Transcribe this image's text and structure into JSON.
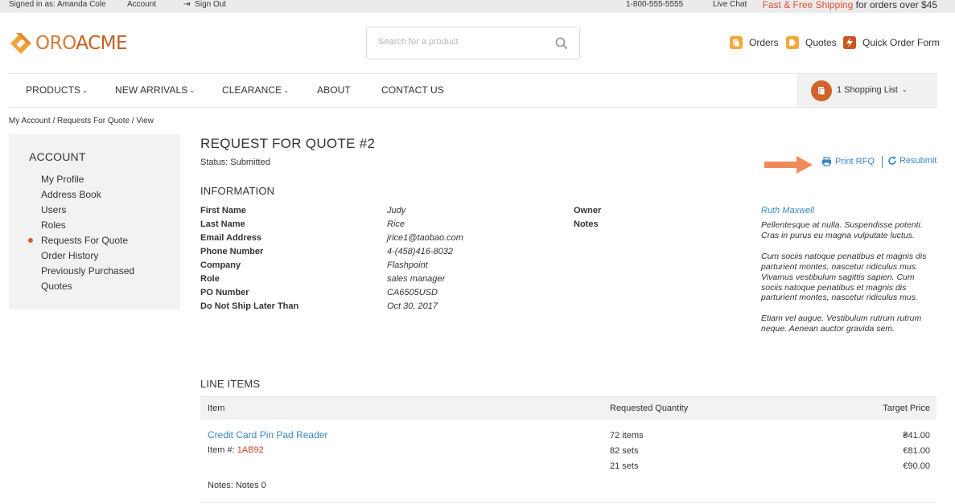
{
  "topbar": {
    "signed_in": "Signed in as: Amanda Cole",
    "account": "Account",
    "sign_out": "Sign Out",
    "phone": "1-800-555-5555",
    "live_chat": "Live Chat",
    "promo_accent": "Fast & Free Shipping",
    "promo_rest": " for orders over $45"
  },
  "header": {
    "logo_part1": "ORO",
    "logo_part2": "ACME",
    "search_placeholder": "Search for a product",
    "orders": "Orders",
    "quotes": "Quotes",
    "quick_order": "Quick Order Form"
  },
  "nav": {
    "items": [
      "PRODUCTS",
      "NEW ARRIVALS",
      "CLEARANCE",
      "ABOUT",
      "CONTACT US"
    ],
    "shopping_list": "1 Shopping List"
  },
  "breadcrumb": "My Account / Requests For Quote / View",
  "sidebar": {
    "title": "ACCOUNT",
    "items": [
      "My Profile",
      "Address Book",
      "Users",
      "Roles",
      "Requests For Quote",
      "Order History",
      "Previously Purchased",
      "Quotes"
    ],
    "active_index": 4
  },
  "main": {
    "title": "REQUEST FOR QUOTE #2",
    "status": "Status: Submitted",
    "print": "Print RFQ",
    "resubmit": "Resubmit",
    "information_title": "INFORMATION",
    "fields": [
      {
        "label": "First Name",
        "value": "Judy"
      },
      {
        "label": "Last Name",
        "value": "Rice"
      },
      {
        "label": "Email Address",
        "value": "jrice1@taobao.com"
      },
      {
        "label": "Phone Number",
        "value": "4-(458)416-8032"
      },
      {
        "label": "Company",
        "value": "Flashpoint"
      },
      {
        "label": "Role",
        "value": "sales manager"
      },
      {
        "label": "PO Number",
        "value": "CA6505USD"
      },
      {
        "label": "Do Not Ship Later Than",
        "value": "Oct 30, 2017"
      }
    ],
    "owner_label": "Owner",
    "owner_value": "Ruth Maxwell",
    "notes_label": "Notes",
    "notes_paragraphs": [
      "Pellentesque at nulla. Suspendisse potenti. Cras in purus eu magna vulputate luctus.",
      "Cum sociis natoque penatibus et magnis dis parturient montes, nascetur ridiculus mus. Vivamus vestibulum sagittis sapien. Cum sociis natoque penatibus et magnis dis parturient montes, nascetur ridiculus mus.",
      "Etiam vel augue. Vestibulum rutrum rutrum neque. Aenean auctor gravida sem."
    ],
    "line_items_title": "LINE ITEMS",
    "table_headers": {
      "item": "Item",
      "quantity": "Requested Quantity",
      "price": "Target Price"
    },
    "line_item": {
      "product": "Credit Card Pin Pad Reader",
      "item_label": "Item #: ",
      "sku": "1AB92",
      "quantities": [
        "72 items",
        "82 sets",
        "21 sets"
      ],
      "prices": [
        "₴41.00",
        "€81.00",
        "€90.00"
      ],
      "notes": "Notes: Notes 0"
    }
  },
  "colors": {
    "brand_orange": "#d1622a",
    "link_blue": "#3b86c4",
    "arrow": "#ef8a5a"
  }
}
